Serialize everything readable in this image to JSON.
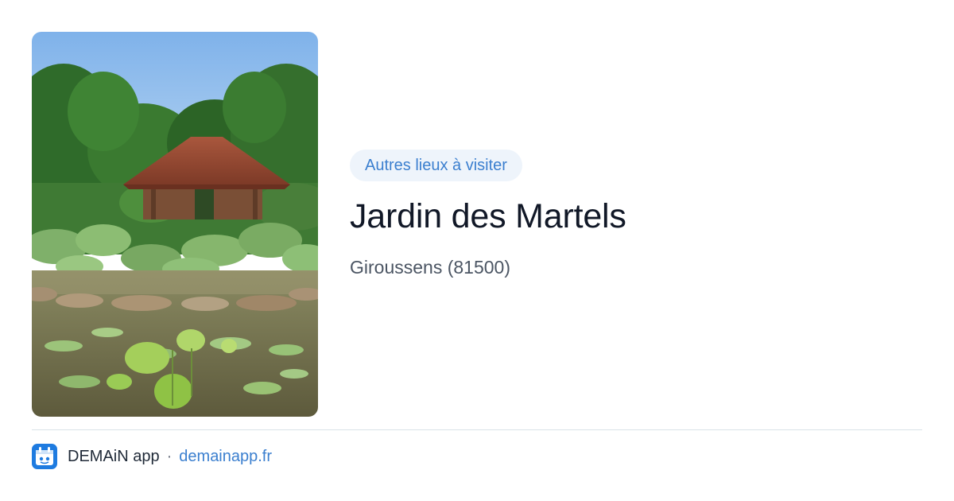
{
  "badge": {
    "label": "Autres lieux à visiter"
  },
  "place": {
    "title": "Jardin des Martels",
    "location": "Giroussens (81500)"
  },
  "footer": {
    "app_name": "DEMAiN app",
    "separator": "·",
    "link": "demainapp.fr"
  },
  "colors": {
    "accent": "#3b7fcf",
    "badge_background": "#eef4fb",
    "title": "#111827",
    "subtitle": "#4b5563",
    "divider": "#d9e2e8"
  },
  "icons": {
    "app_logo": "demain-app-logo-icon"
  }
}
